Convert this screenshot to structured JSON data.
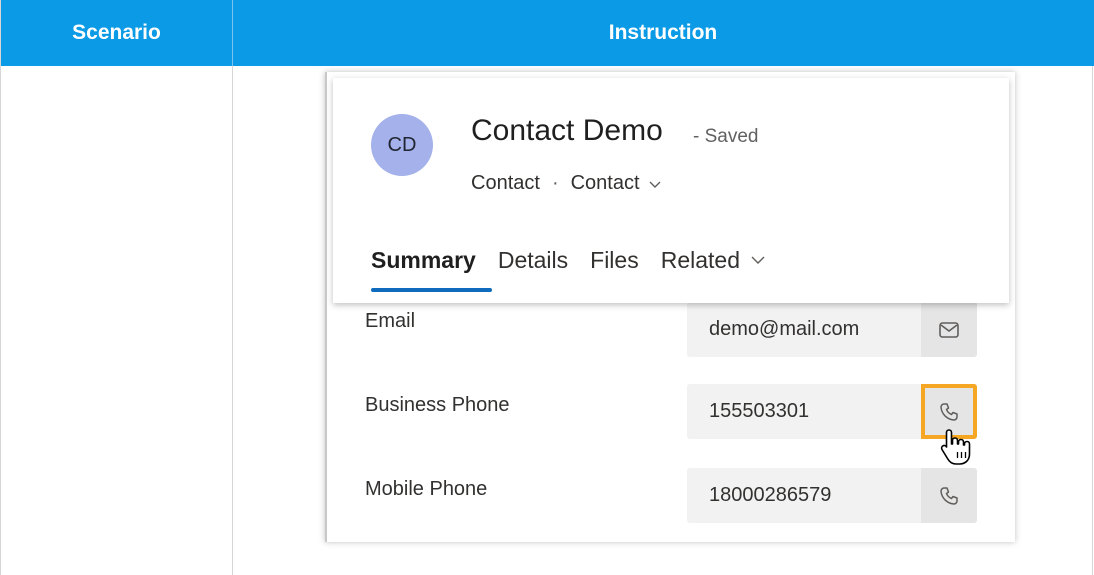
{
  "table": {
    "headers": [
      "Scenario",
      "Instruction"
    ]
  },
  "contact": {
    "avatar_initials": "CD",
    "name": "Contact Demo",
    "status": "- Saved",
    "entity": "Contact",
    "separator": "·",
    "form": "Contact"
  },
  "tabs": [
    "Summary",
    "Details",
    "Files",
    "Related"
  ],
  "fields": [
    {
      "label": "Email",
      "value": "demo@mail.com",
      "action_icon": "mail-icon"
    },
    {
      "label": "Business Phone",
      "value": "155503301",
      "action_icon": "phone-icon"
    },
    {
      "label": "Mobile Phone",
      "value": "18000286579",
      "action_icon": "phone-icon"
    }
  ],
  "colors": {
    "header_bg": "#0b9ae6",
    "accent": "#0f6cbd",
    "highlight": "#f5a623",
    "avatar_bg": "#a4b1ea"
  }
}
